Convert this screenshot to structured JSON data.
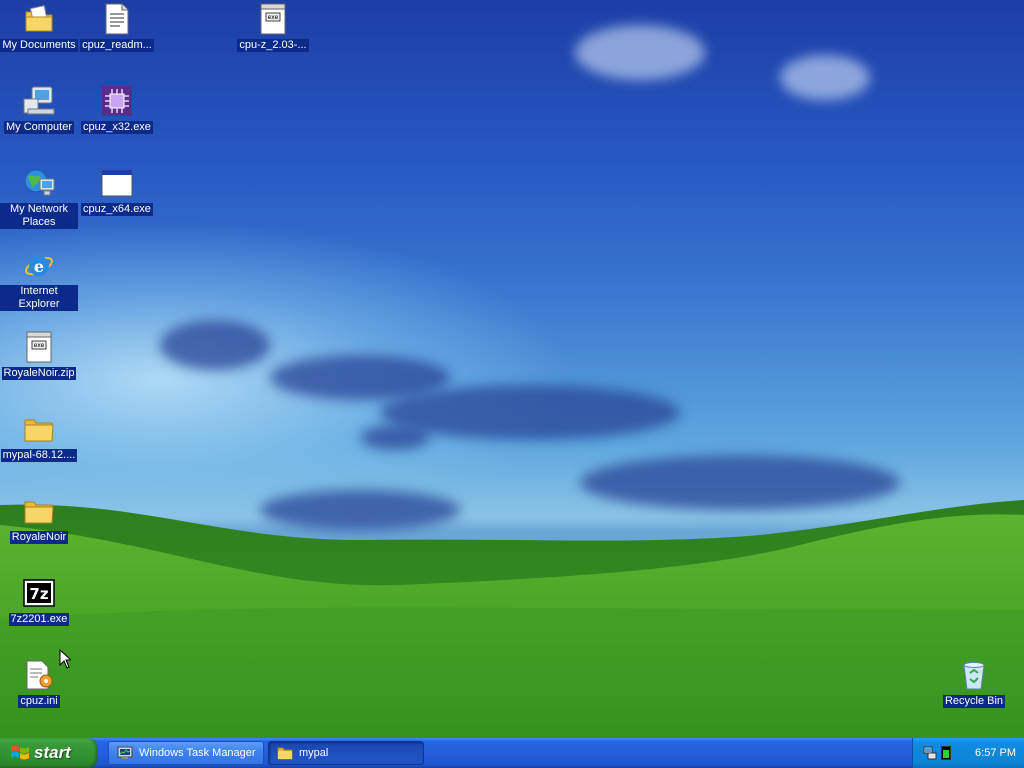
{
  "desktop": {
    "icons": [
      {
        "label": "My Documents",
        "icon": "my-documents-icon"
      },
      {
        "label": "cpuz_readm...",
        "icon": "text-file-icon"
      },
      {
        "label": "cpu-z_2.03-...",
        "icon": "zip-file-icon"
      },
      {
        "label": "My Computer",
        "icon": "computer-icon"
      },
      {
        "label": "cpuz_x32.exe",
        "icon": "cpuz-app-icon"
      },
      {
        "label": "My Network Places",
        "icon": "network-places-icon"
      },
      {
        "label": "cpuz_x64.exe",
        "icon": "exe-window-icon"
      },
      {
        "label": "Internet Explorer",
        "icon": "internet-explorer-icon"
      },
      {
        "label": "RoyaleNoir.zip",
        "icon": "zip-file-icon"
      },
      {
        "label": "mypal-68.12....",
        "icon": "folder-icon"
      },
      {
        "label": "RoyaleNoir",
        "icon": "folder-icon"
      },
      {
        "label": "7z2201.exe",
        "icon": "7zip-icon"
      },
      {
        "label": "cpuz.ini",
        "icon": "ini-settings-icon"
      },
      {
        "label": "Recycle Bin",
        "icon": "recycle-bin-icon"
      }
    ]
  },
  "taskbar": {
    "start_label": "start",
    "tasks": [
      {
        "label": "Windows Task Manager",
        "icon": "task-manager-icon",
        "active": false
      },
      {
        "label": "mypal",
        "icon": "folder-icon",
        "active": true
      }
    ],
    "tray": {
      "clock": "6:57 PM",
      "icons": [
        "network-icon",
        "cpu-usage-icon"
      ]
    }
  },
  "colors": {
    "taskbar_blue": "#245edb",
    "start_green": "#3a9a3a",
    "tray_blue": "#0f8ae0",
    "icon_label_bg": "#0b2a8a"
  }
}
